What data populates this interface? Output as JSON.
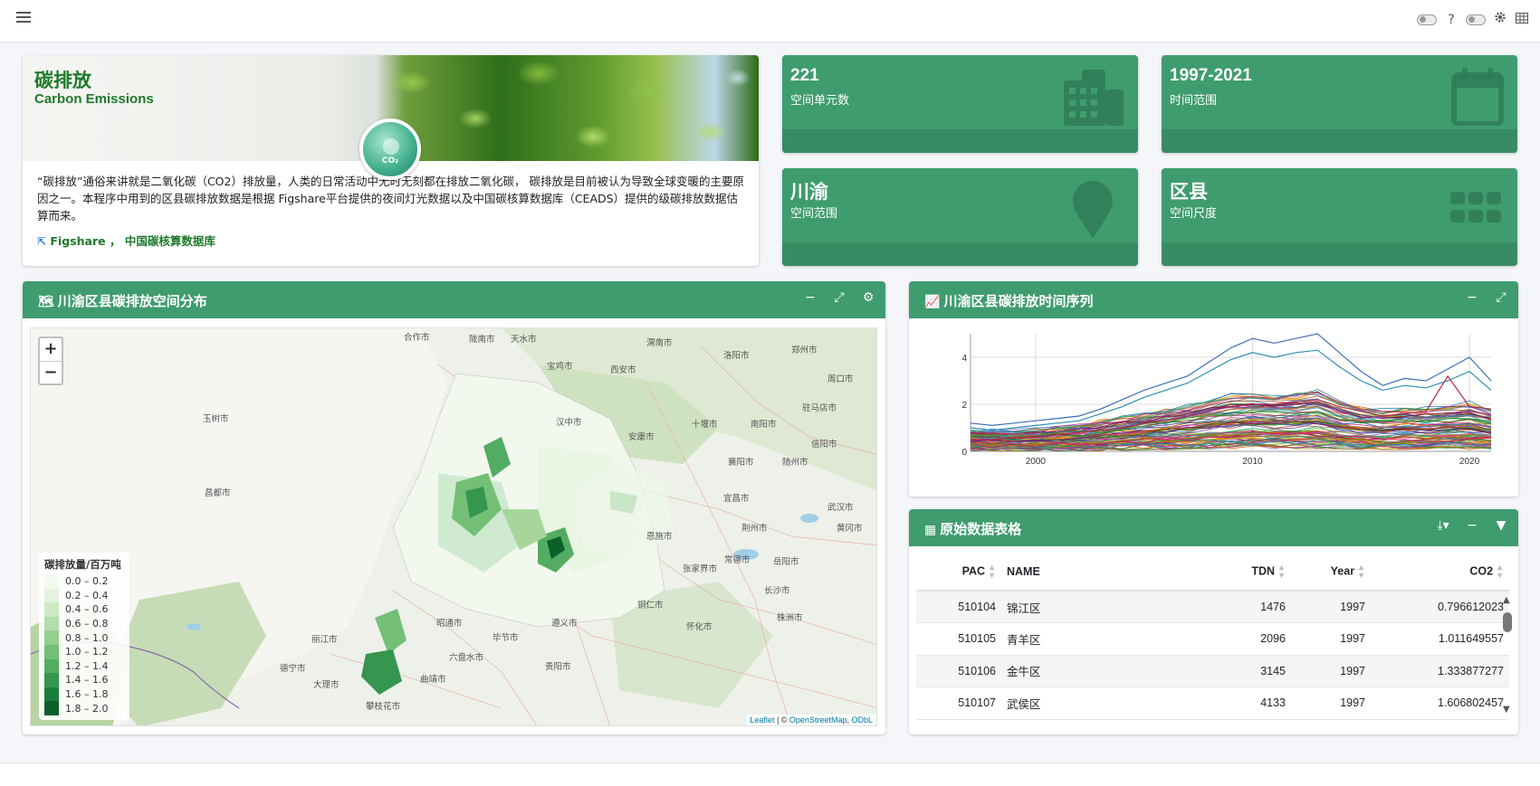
{
  "navbar": {
    "menu_icon": "hamburger-icon",
    "help_label": "?",
    "settings_icon": "gear-icon",
    "grid_icon": "grid-icon"
  },
  "intro": {
    "title": "碳排放",
    "subtitle": "Carbon Emissions",
    "badge": "CO₂",
    "description": "“碳排放”通俗来讲就是二氧化碳（CO2）排放量，人类的日常活动中无时无刻都在排放二氧化碳，  碳排放是目前被认为导致全球变暖的主要原因之一。本程序中用到的区县碳排放数据是根据 Figshare平台提供的夜间灯光数据以及中国碳核算数据库（CEADS）提供的级碳排放数据估算而来。",
    "link1": "Figshare",
    "separator": "，",
    "link2": "中国碳核算数据库"
  },
  "info_boxes": [
    {
      "value": "221",
      "label": "空间单元数",
      "icon": "building-icon"
    },
    {
      "value": "1997-2021",
      "label": "时间范围",
      "icon": "calendar-icon"
    },
    {
      "value": "川渝",
      "label": "空间范围",
      "icon": "map-marker-icon"
    },
    {
      "value": "区县",
      "label": "空间尺度",
      "icon": "th-grid-icon"
    }
  ],
  "map_panel": {
    "title": "川渝区县碳排放空间分布",
    "zoom_in": "+",
    "zoom_out": "−",
    "legend_title": "碳排放量/百万吨",
    "legend": [
      {
        "label": "0.0 – 0.2",
        "color": "#f3faf0"
      },
      {
        "label": "0.2 – 0.4",
        "color": "#e3f3dd"
      },
      {
        "label": "0.4 – 0.6",
        "color": "#cdeac5"
      },
      {
        "label": "0.6 – 0.8",
        "color": "#b3ddab"
      },
      {
        "label": "0.8 – 1.0",
        "color": "#94cf90"
      },
      {
        "label": "1.0 – 1.2",
        "color": "#73bf76"
      },
      {
        "label": "1.2 – 1.4",
        "color": "#52ac62"
      },
      {
        "label": "1.4 – 1.6",
        "color": "#35964f"
      },
      {
        "label": "1.6 – 1.8",
        "color": "#1c7c3b"
      },
      {
        "label": "1.8 – 2.0",
        "color": "#0b5f2a"
      }
    ],
    "attribution_leaflet": "Leaflet",
    "attribution_sep": " | © ",
    "attribution_osm": "OpenStreetMap",
    "attribution_odbl": "ODbL",
    "place_labels": [
      "合作市",
      "陇南市",
      "天水市",
      "宝鸡市",
      "西安市",
      "渭南市",
      "洛阳市",
      "郑州市",
      "周口市",
      "汉中市",
      "安康市",
      "十堰市",
      "南阳市",
      "驻马店市",
      "信阳市",
      "随州市",
      "襄阳市",
      "宜昌市",
      "荆州市",
      "武汉市",
      "黄冈市",
      "恩施市",
      "常德市",
      "岳阳市",
      "长沙市",
      "株洲市",
      "张家界市",
      "怀化市",
      "遵义市",
      "铜仁市",
      "贵阳市",
      "六盘水市",
      "毕节市",
      "昭通市",
      "曲靖市",
      "丽江市",
      "大理市",
      "攀枝花市",
      "玉树市",
      "昌都市",
      "德宁市"
    ]
  },
  "chart_panel": {
    "title": "川渝区县碳排放时间序列",
    "chart_data": {
      "type": "line",
      "x_range": [
        1997,
        2021
      ],
      "ylim": [
        0,
        5
      ],
      "x_ticks": [
        2000,
        2010,
        2020
      ],
      "y_ticks": [
        0,
        2,
        4
      ],
      "grid": true,
      "legend": "none",
      "series_count": 221,
      "highlight_series": [
        {
          "color": "#3f6fb5",
          "values": [
            1.2,
            1.1,
            1.2,
            1.3,
            1.4,
            1.5,
            1.8,
            2.2,
            2.6,
            2.9,
            3.2,
            3.8,
            4.4,
            4.8,
            4.6,
            4.8,
            5.0,
            4.2,
            3.4,
            2.8,
            3.1,
            3.0,
            3.5,
            4.0,
            3.0
          ]
        },
        {
          "color": "#2f8fb0",
          "values": [
            1.0,
            0.9,
            1.0,
            1.1,
            1.2,
            1.3,
            1.6,
            1.9,
            2.3,
            2.6,
            2.9,
            3.4,
            3.9,
            4.2,
            4.0,
            4.2,
            4.3,
            3.6,
            3.0,
            2.6,
            2.8,
            2.7,
            3.0,
            3.4,
            2.6
          ]
        },
        {
          "color": "#b5224a",
          "values": [
            0.5,
            0.5,
            0.6,
            0.6,
            0.7,
            0.8,
            0.9,
            1.0,
            1.2,
            1.3,
            1.5,
            1.7,
            1.9,
            2.0,
            2.0,
            2.1,
            2.2,
            1.9,
            1.7,
            1.5,
            1.6,
            1.7,
            3.2,
            1.9,
            1.8
          ]
        }
      ]
    }
  },
  "table_panel": {
    "title": "原始数据表格",
    "columns": [
      "PAC",
      "NAME",
      "TDN",
      "Year",
      "CO2"
    ],
    "rows": [
      [
        "510104",
        "锦江区",
        "1476",
        "1997",
        "0.796612023"
      ],
      [
        "510105",
        "青羊区",
        "2096",
        "1997",
        "1.011649557"
      ],
      [
        "510106",
        "金牛区",
        "3145",
        "1997",
        "1.333877277"
      ],
      [
        "510107",
        "武侯区",
        "4133",
        "1997",
        "1.606802457"
      ]
    ]
  },
  "colors": {
    "accent": "#3f9c6e",
    "accent_dark": "#388c63",
    "title_green": "#1e7a2a"
  }
}
